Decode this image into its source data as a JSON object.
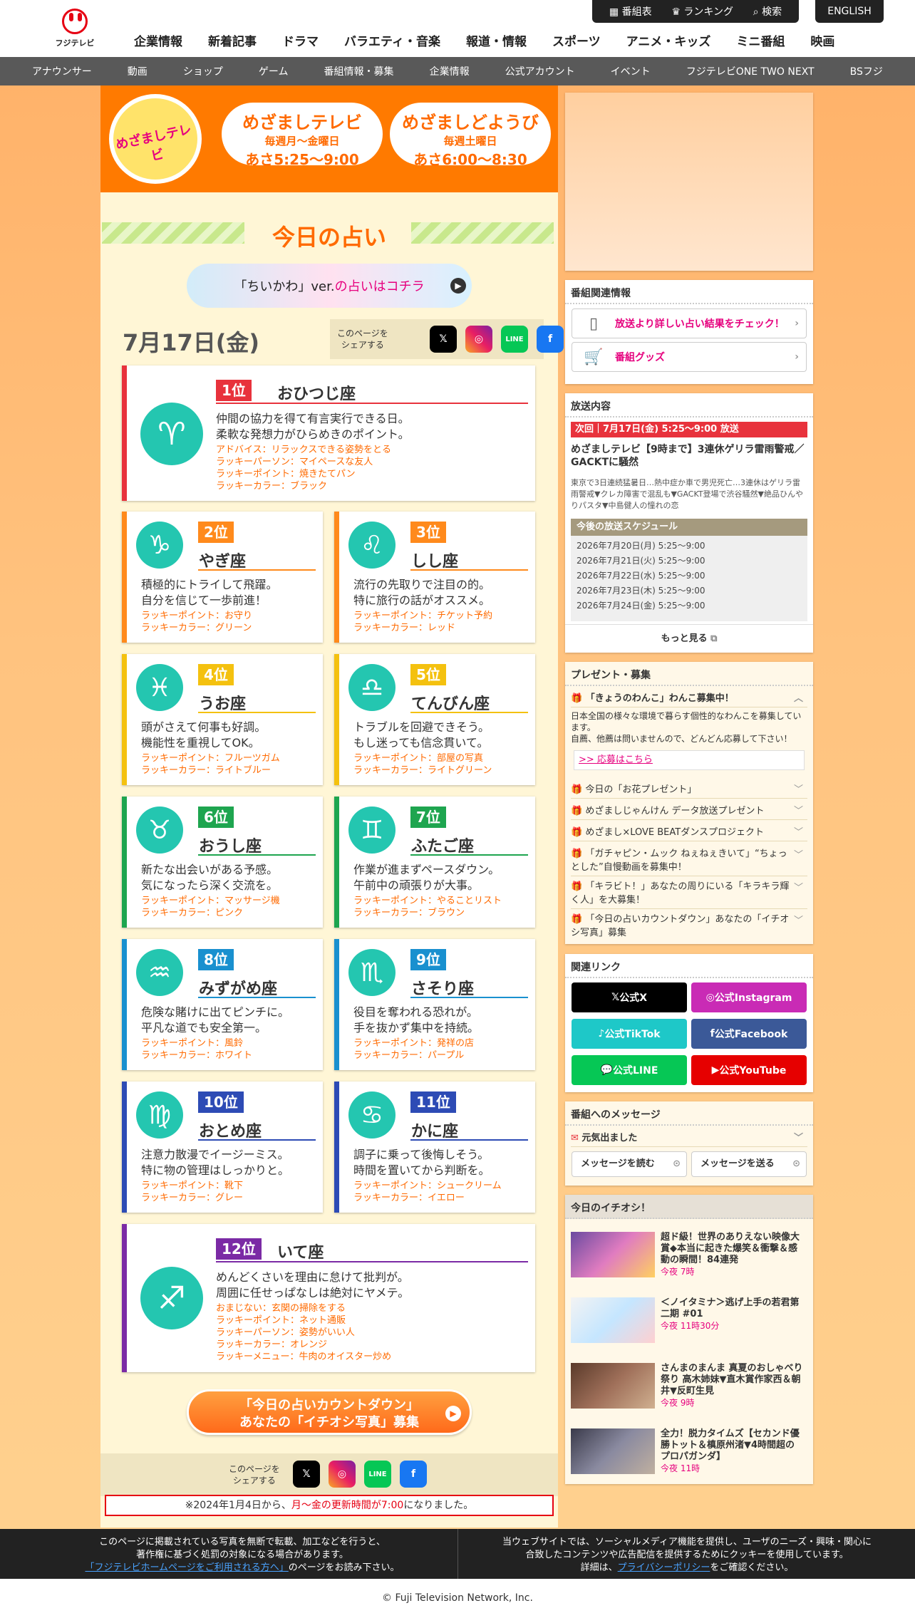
{
  "header": {
    "logo_text": "フジテレビ",
    "utility": [
      "番組表",
      "ランキング",
      "検索"
    ],
    "english": "ENGLISH",
    "gnav": [
      "企業情報",
      "新着記事",
      "ドラマ",
      "バラエティ・音楽",
      "報道・情報",
      "スポーツ",
      "アニメ・キッズ",
      "ミニ番組",
      "映画"
    ],
    "snav": [
      "アナウンサー",
      "動画",
      "ショップ",
      "ゲーム",
      "番組情報・募集",
      "企業情報",
      "公式アカウント",
      "イベント",
      "フジテレビONE TWO NEXT",
      "BSフジ"
    ]
  },
  "banner": {
    "logo": "めざましテレビ",
    "p1": {
      "a": "めざましテレビ",
      "b": "毎週月〜金曜日",
      "c": "あさ5:25〜9:00"
    },
    "p2": {
      "a": "めざましどようび",
      "b": "毎週土曜日",
      "c": "あさ6:00〜8:30"
    }
  },
  "title": "今日の占い",
  "chiikawa": {
    "a": "「ちいかわ」ver.",
    "b": "の占いはコチラ"
  },
  "date": "7月17日(金)",
  "share_label": "このページを\nシェアする",
  "ranks": [
    {
      "rank": "1位",
      "name": "おひつじ座",
      "sym": "♈",
      "desc": [
        "仲間の協力を得て有言実行できる日。",
        "柔軟な発想力がひらめきのポイント。"
      ],
      "lucky": [
        "アドバイス：リラックスできる姿勢をとる",
        "ラッキーパーソン：マイペースな友人",
        "ラッキーポイント：焼きたてパン",
        "ラッキーカラー：ブラック"
      ]
    },
    {
      "rank": "2位",
      "name": "やぎ座",
      "sym": "♑",
      "desc": [
        "積極的にトライして飛躍。",
        "自分を信じて一歩前進！"
      ],
      "lucky": [
        "ラッキーポイント：お守り",
        "ラッキーカラー：グリーン"
      ]
    },
    {
      "rank": "3位",
      "name": "しし座",
      "sym": "♌",
      "desc": [
        "流行の先取りで注目の的。",
        "特に旅行の話がオススメ。"
      ],
      "lucky": [
        "ラッキーポイント：チケット予約",
        "ラッキーカラー：レッド"
      ]
    },
    {
      "rank": "4位",
      "name": "うお座",
      "sym": "♓",
      "desc": [
        "頭がさえて何事も好調。",
        "機能性を重視してOK。"
      ],
      "lucky": [
        "ラッキーポイント：フルーツガム",
        "ラッキーカラー：ライトブルー"
      ]
    },
    {
      "rank": "5位",
      "name": "てんびん座",
      "sym": "♎",
      "desc": [
        "トラブルを回避できそう。",
        "もし迷っても信念貫いて。"
      ],
      "lucky": [
        "ラッキーポイント：部屋の写真",
        "ラッキーカラー：ライトグリーン"
      ]
    },
    {
      "rank": "6位",
      "name": "おうし座",
      "sym": "♉",
      "desc": [
        "新たな出会いがある予感。",
        "気になったら深く交流を。"
      ],
      "lucky": [
        "ラッキーポイント：マッサージ機",
        "ラッキーカラー：ピンク"
      ]
    },
    {
      "rank": "7位",
      "name": "ふたご座",
      "sym": "♊",
      "desc": [
        "作業が進まずペースダウン。",
        "午前中の頑張りが大事。"
      ],
      "lucky": [
        "ラッキーポイント：やることリスト",
        "ラッキーカラー：ブラウン"
      ]
    },
    {
      "rank": "8位",
      "name": "みずがめ座",
      "sym": "♒",
      "desc": [
        "危険な賭けに出てピンチに。",
        "平凡な道でも安全第一。"
      ],
      "lucky": [
        "ラッキーポイント：風鈴",
        "ラッキーカラー：ホワイト"
      ]
    },
    {
      "rank": "9位",
      "name": "さそり座",
      "sym": "♏",
      "desc": [
        "役目を奪われる恐れが。",
        "手を抜かず集中を持続。"
      ],
      "lucky": [
        "ラッキーポイント：発祥の店",
        "ラッキーカラー：パープル"
      ]
    },
    {
      "rank": "10位",
      "name": "おとめ座",
      "sym": "♍",
      "desc": [
        "注意力散漫でイージーミス。",
        "特に物の管理はしっかりと。"
      ],
      "lucky": [
        "ラッキーポイント：靴下",
        "ラッキーカラー：グレー"
      ]
    },
    {
      "rank": "11位",
      "name": "かに座",
      "sym": "♋",
      "desc": [
        "調子に乗って後悔しそう。",
        "時間を置いてから判断を。"
      ],
      "lucky": [
        "ラッキーポイント：シュークリーム",
        "ラッキーカラー：イエロー"
      ]
    },
    {
      "rank": "12位",
      "name": "いて座",
      "sym": "♐",
      "desc": [
        "めんどくさいを理由に怠けて批判が。",
        "周囲に任せっぱなしは絶対にヤメテ。"
      ],
      "lucky": [
        "おまじない：玄関の掃除をする",
        "ラッキーポイント：ネット通販",
        "ラッキーパーソン：姿勢がいい人",
        "ラッキーカラー：オレンジ",
        "ラッキーメニュー：牛肉のオイスター炒め"
      ]
    }
  ],
  "countdown": {
    "a": "「今日の占いカウントダウン」",
    "b": "あなたの「イチオシ写真」募集"
  },
  "notice": {
    "a": "※2024年1月4日から、",
    "b": "月〜金の更新時間が7:00",
    "c": "になりました。"
  },
  "side": {
    "related": {
      "h": "番組関連情報",
      "b1": "放送より詳しい占い結果をチェック！",
      "b2": "番組グッズ"
    },
    "broadcast": {
      "h": "放送内容",
      "next": "次回｜7月17日(金) 5:25〜9:00 放送",
      "title": "めざましテレビ【9時まで】3連休ゲリラ雷雨警戒／GACKTに騒然",
      "body": "東京で3日連続猛暑日…熱中症か車で男児死亡…3連休はゲリラ雷雨警戒▼クレカ障害で混乱も▼GACKT登場で渋谷騒然▼絶品ひんやりパスタ▼中島健人の憧れの恋",
      "sch_h": "今後の放送スケジュール",
      "sch": [
        "2026年7月20日(月) 5:25〜9:00",
        "2026年7月21日(火) 5:25〜9:00",
        "2026年7月22日(水) 5:25〜9:00",
        "2026年7月23日(木) 5:25〜9:00",
        "2026年7月24日(金) 5:25〜9:00"
      ],
      "more": "もっと見る"
    },
    "present": {
      "h": "プレゼント・募集",
      "open": "「きょうのわんこ」わんこ募集中！",
      "open_body": "日本全国の様々な環境で暮らす個性的なわんこを募集しています。\n自薦、他薦は問いませんので、どんどん応募して下さい！",
      "apply": ">> 応募はこちら",
      "items": [
        "今日の「お花プレゼント」",
        "めざましじゃんけん データ放送プレゼント",
        "めざまし×LOVE BEATダンスプロジェクト",
        "「ガチャピン・ムック ねぇねぇきいて」“ちょっとした”自慢動画を募集中！",
        "「キラビト！」あなたの周りにいる「キラキラ輝く人」を大募集！",
        "「今日の占いカウントダウン」あなたの「イチオシ写真」募集"
      ]
    },
    "links": {
      "h": "関連リンク",
      "items": [
        "公式X",
        "公式Instagram",
        "公式TikTok",
        "公式Facebook",
        "公式LINE",
        "公式YouTube"
      ]
    },
    "message": {
      "h": "番組へのメッセージ",
      "item": "元気出ました",
      "read": "メッセージを読む",
      "send": "メッセージを送る"
    },
    "pickup": {
      "h": "今日のイチオシ！",
      "items": [
        {
          "t": "超ド級！世界のありえない映像大賞◆本当に起きた爆笑＆衝撃＆感動の瞬間！84連発",
          "tm": "今夜 7時"
        },
        {
          "t": "＜ノイタミナ＞逃げ上手の若君第二期 #01",
          "tm": "今夜 11時30分"
        },
        {
          "t": "さんまのまんま 真夏のおしゃべり祭り 高木姉妹▼直木賞作家西＆朝井▼反町生見",
          "tm": "今夜 9時"
        },
        {
          "t": "全力！脱力タイムズ【セカンド優勝トット＆槙原州渚▼4時間超のプロパガンダ】",
          "tm": "今夜 11時"
        }
      ]
    }
  },
  "footer": {
    "c1a": "このページに掲載されている写真を無断で転載、加工などを行うと、",
    "c1b": "著作権に基づく処罰の対象になる場合があります。",
    "c1c": "「フジテレビホームページをご利用される方へ」",
    "c1d": "のページをお読み下さい。",
    "c2a": "当ウェブサイトでは、ソーシャルメディア機能を提供し、ユーザのニーズ・興味・関心に",
    "c2b": "合致したコンテンツや広告配信を提供するためにクッキーを使用しています。",
    "c2c": "詳細は、",
    "c2d": "プライバシーポリシー",
    "c2e": "をご確認ください。",
    "copy": "© Fuji Television Network, Inc."
  },
  "colors": {
    "orange": "#ff6a00",
    "red": "#e8323c",
    "pink": "#e6007e"
  }
}
